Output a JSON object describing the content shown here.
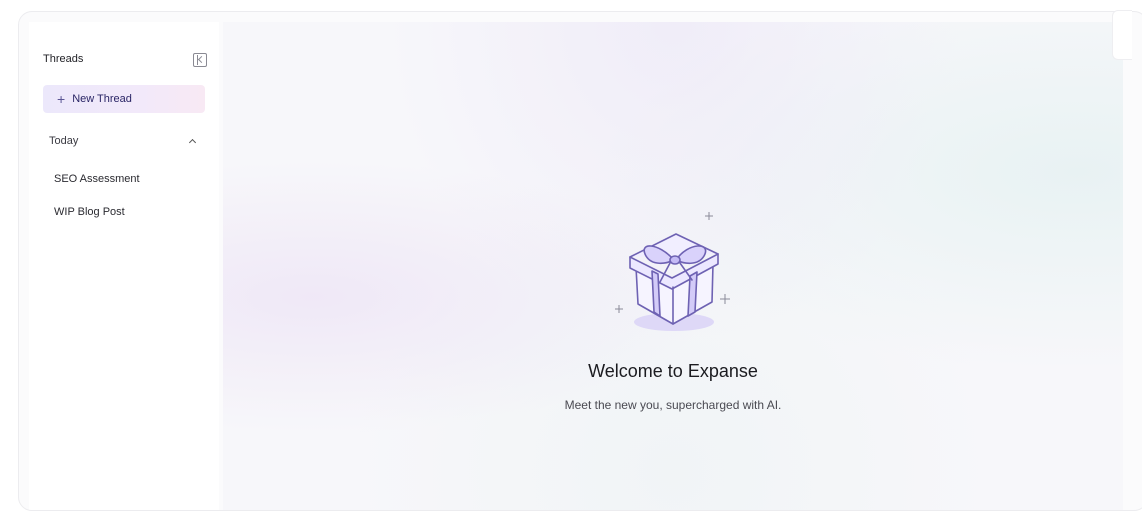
{
  "sidebar": {
    "title": "Threads",
    "new_thread_label": "New Thread",
    "sections": [
      {
        "label": "Today",
        "items": [
          {
            "label": "SEO Assessment"
          },
          {
            "label": "WIP Blog Post"
          }
        ]
      }
    ]
  },
  "main": {
    "welcome_title": "Welcome to Expanse",
    "welcome_subtitle": "Meet the new you, supercharged with AI."
  },
  "icons": {
    "collapse": "sidebar-collapse-icon",
    "plus": "plus-icon",
    "chevron": "chevron-up-icon",
    "illustration": "gift-box-icon"
  },
  "colors": {
    "accent": "#7b6cc0",
    "new_thread_bg": "#ece8fb",
    "new_thread_text": "#2a2566"
  }
}
